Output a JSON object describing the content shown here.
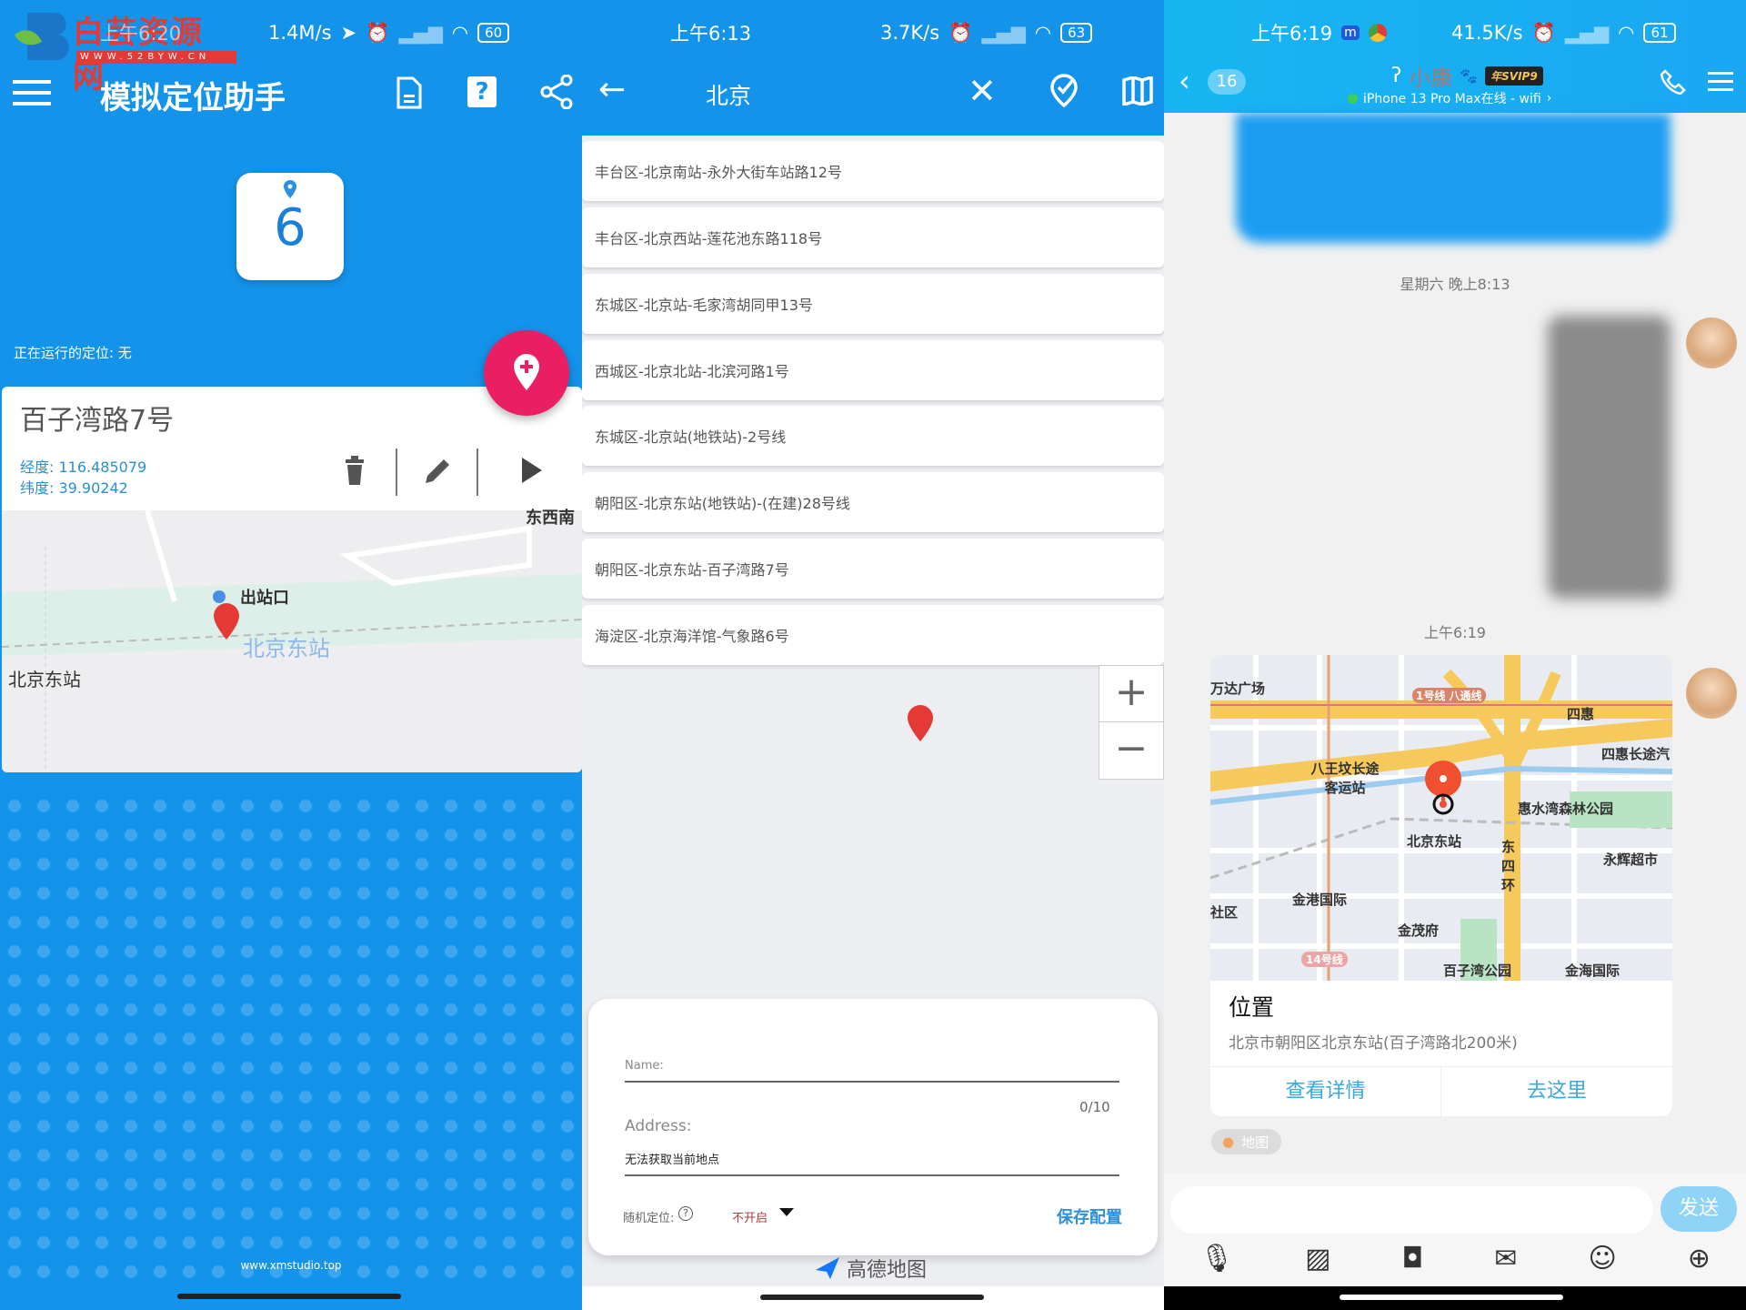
{
  "left": {
    "watermark": {
      "brand": "白芸资源网",
      "url": "WWW.52BYW.CN"
    },
    "status": {
      "time": "上午6:20",
      "speed": "1.4M/s",
      "battery": "60"
    },
    "appbar": {
      "title": "模拟定位助手",
      "icons": [
        "menu-icon",
        "document-icon",
        "help-icon",
        "share-icon"
      ]
    },
    "counter": "6",
    "running": "正在运行的定位: 无",
    "location": {
      "name": "百子湾路7号",
      "lng": "经度: 116.485079",
      "lat": "纬度: 39.90242"
    },
    "map_labels": {
      "exit": "出站口",
      "station": "北京东站",
      "station_big": "北京东站",
      "top_right": "东西南"
    },
    "footer": "www.xmstudio.top",
    "colors": {
      "primary": "#1493ea",
      "fab": "#e91e63"
    }
  },
  "middle": {
    "status": {
      "time": "上午6:13",
      "speed": "3.7K/s",
      "battery": "63"
    },
    "appbar": {
      "search": "北京",
      "icons": [
        "back-arrow-icon",
        "close-icon",
        "location-check-icon",
        "map-icon"
      ]
    },
    "results": [
      "丰台区-北京南站-永外大街车站路12号",
      "丰台区-北京西站-莲花池东路118号",
      "东城区-北京站-毛家湾胡同甲13号",
      "西城区-北京北站-北滨河路1号",
      "东城区-北京站(地铁站)-2号线",
      "朝阳区-北京东站(地铁站)-(在建)28号线",
      "朝阳区-北京东站-百子湾路7号",
      "海淀区-北京海洋馆-气象路6号"
    ],
    "zoom": {
      "in": "+",
      "out": "−"
    },
    "form": {
      "name_label": "Name:",
      "name_value": "",
      "counter": "0/10",
      "address_label": "Address:",
      "address_value": "无法获取当前地点",
      "random_label": "随机定位:",
      "random_value": "不开启",
      "save": "保存配置"
    },
    "map_logo": "高德地图"
  },
  "right": {
    "status": {
      "time": "上午6:19",
      "speed": "41.5K/s",
      "battery": "61"
    },
    "header": {
      "unread": "16",
      "contact": "小康",
      "vip": "年SVIP9",
      "online": "iPhone 13 Pro Max在线 - wifi"
    },
    "times": [
      "星期六 晚上8:13",
      "上午6:19"
    ],
    "location_card": {
      "title": "位置",
      "address": "北京市朝阳区北京东站(百子湾路北200米)",
      "details": "查看详情",
      "go": "去这里",
      "map_labels": [
        "万达广场",
        "1号线 八通线",
        "四惠",
        "四惠长途汽",
        "八王坟长途 客运站",
        "北京东站",
        "惠水湾森林公园",
        "东四环",
        "永辉超市",
        "社区",
        "金港国际",
        "金茂府",
        "14号线",
        "百子湾公园",
        "金海国际"
      ]
    },
    "source_tag": "地图",
    "send": "发送",
    "toolbar": [
      "microphone-icon",
      "image-icon",
      "camera-icon",
      "red-packet-icon",
      "emoji-icon",
      "plus-icon"
    ]
  }
}
